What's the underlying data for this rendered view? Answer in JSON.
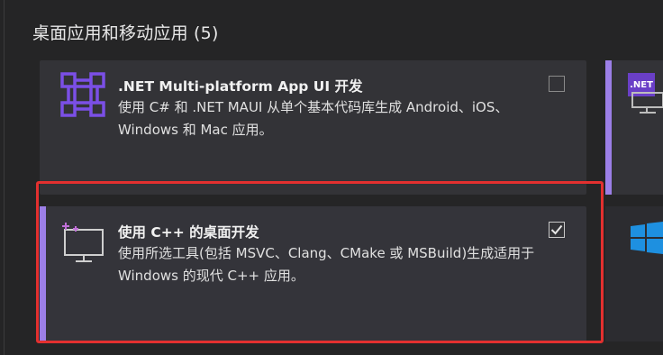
{
  "section": {
    "title": "桌面应用和移动应用 (5)"
  },
  "workloads": [
    {
      "title": ".NET Multi-platform App UI 开发",
      "description": "使用 C# 和 .NET MAUI 从单个基本代码库生成 Android、iOS、Windows 和 Mac 应用。",
      "checked": false,
      "icon": "maui-grid-icon"
    },
    {
      "title": "使用 C++ 的桌面开发",
      "description": "使用所选工具(包括 MSVC、Clang、CMake 或 MSBuild)生成适用于 Windows 的现代 C++ 应用。",
      "checked": true,
      "icon": "desktop-monitor-icon"
    }
  ],
  "right_partial": {
    "badge_text": ".NET"
  },
  "colors": {
    "accent": "#9c7fe7",
    "highlight": "#e3302f",
    "maui_purple": "#6a3fc7"
  }
}
